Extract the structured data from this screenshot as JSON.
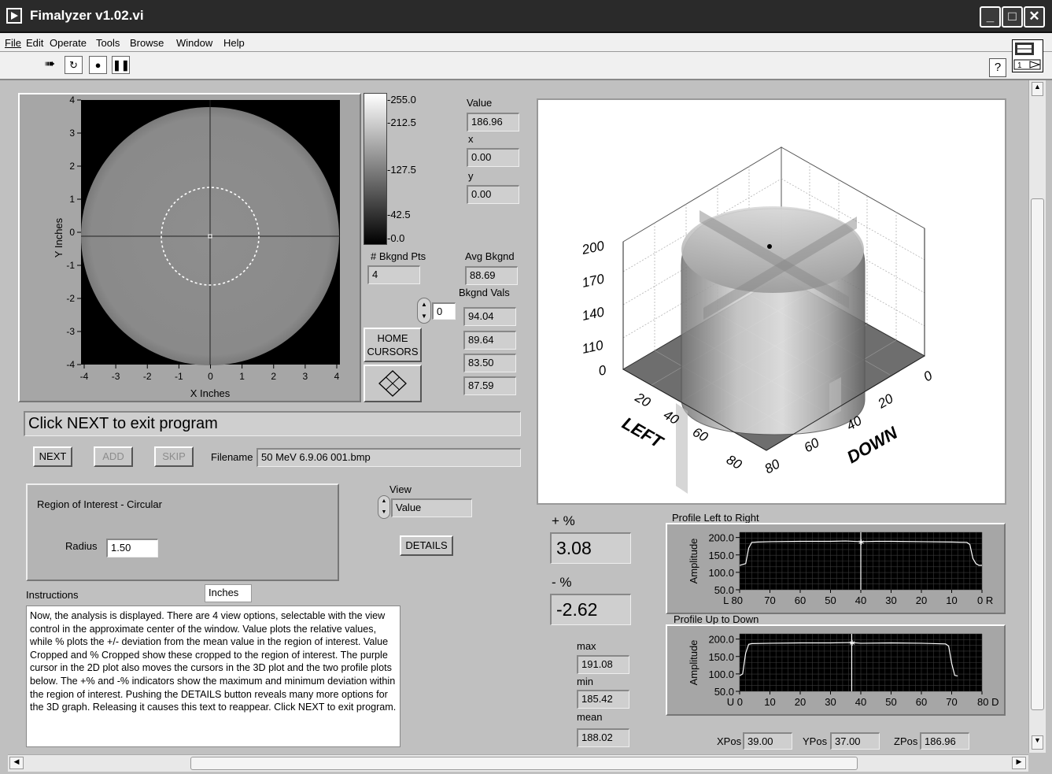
{
  "window": {
    "title": "Fimalyzer v1.02.vi"
  },
  "menu": {
    "items": [
      "File",
      "Edit",
      "Operate",
      "Tools",
      "Browse",
      "Window",
      "Help"
    ]
  },
  "toolbar": {
    "help_label": "?",
    "context_num": "1"
  },
  "plot2d": {
    "ylabel": "Y Inches",
    "xlabel": "X Inches",
    "yticks": [
      "4",
      "3",
      "2",
      "1",
      "0",
      "-1",
      "-2",
      "-3",
      "-4"
    ],
    "xticks": [
      "-4",
      "-3",
      "-2",
      "-1",
      "0",
      "1",
      "2",
      "3",
      "4"
    ]
  },
  "colorbar": {
    "ticks": [
      "-255.0",
      "-212.5",
      "-127.5",
      "-42.5",
      "-0.0"
    ]
  },
  "readouts": {
    "value_label": "Value",
    "value": "186.96",
    "x_label": "x",
    "x": "0.00",
    "y_label": "y",
    "y": "0.00",
    "bkgnd_pts_label": "# Bkgnd Pts",
    "bkgnd_pts": "4",
    "avg_bkgnd_label": "Avg Bkgnd",
    "avg_bkgnd": "88.69",
    "bkgnd_vals_label": "Bkgnd Vals",
    "bkgnd_vals": [
      "94.04",
      "89.64",
      "83.50",
      "87.59"
    ],
    "index": "0"
  },
  "home_cursors_label": [
    "HOME",
    "CURSORS"
  ],
  "status": "Click NEXT to exit program",
  "buttons": {
    "next": "NEXT",
    "add": "ADD",
    "skip": "SKIP",
    "details": "DETAILS"
  },
  "filename": {
    "label": "Filename",
    "value": "50 MeV 6.9.06 001.bmp"
  },
  "roi": {
    "title": "Region of Interest - Circular",
    "radius_label": "Radius",
    "radius": "1.50"
  },
  "view": {
    "label": "View",
    "value": "Value"
  },
  "units": "Inches",
  "instructions": {
    "label": "Instructions",
    "text": "Now, the analysis is displayed. There are 4 view options, selectable with the view control in the approximate center of the window. Value plots the relative values, while % plots the +/- deviation from the mean value in the region of interest. Value Cropped and % Cropped show these cropped to the region of interest. The purple cursor in the 2D plot also moves the cursors in the 3D plot and the two profile plots below. The +% and -% indicators show the maximum and minimum deviation within the region of interest. Pushing the DETAILS button reveals many more options for the 3D graph. Releasing it causes this text to reappear. Click NEXT to exit program."
  },
  "plot3d": {
    "z_ticks": [
      "200",
      "170",
      "140",
      "110",
      "0"
    ],
    "left_ticks": [
      "20",
      "40",
      "60",
      "80"
    ],
    "down_ticks": [
      "0",
      "20",
      "40",
      "60",
      "80"
    ],
    "left_label": "LEFT",
    "down_label": "DOWN"
  },
  "stats": {
    "plus_label": "+ %",
    "plus": "3.08",
    "minus_label": "- %",
    "minus": "-2.62",
    "max_label": "max",
    "max": "191.08",
    "min_label": "min",
    "min": "185.42",
    "mean_label": "mean",
    "mean": "188.02"
  },
  "profiles": [
    {
      "title": "Profile Left to Right",
      "ylabel": "Amplitude",
      "yticks": [
        "200.0",
        "150.0",
        "100.0",
        "50.0"
      ],
      "xticks": [
        "L 80",
        "70",
        "60",
        "50",
        "40",
        "30",
        "20",
        "10",
        "0 R"
      ],
      "x_range": [
        80,
        0
      ],
      "cursor_x": 40,
      "chart_data": {
        "type": "line",
        "x": [
          80,
          78,
          77,
          76,
          74,
          70,
          60,
          50,
          45,
          40,
          35,
          30,
          20,
          10,
          5,
          4,
          3,
          2,
          1,
          0
        ],
        "y": [
          120,
          125,
          170,
          186,
          187,
          188,
          189,
          189,
          190,
          188,
          189,
          189,
          188,
          187,
          186,
          180,
          140,
          125,
          120,
          120
        ],
        "ylim": [
          50,
          215
        ]
      }
    },
    {
      "title": "Profile Up to Down",
      "ylabel": "Amplitude",
      "yticks": [
        "200.0",
        "150.0",
        "100.0",
        "50.0"
      ],
      "xticks": [
        "U 0",
        "10",
        "20",
        "30",
        "40",
        "50",
        "60",
        "70",
        "80 D"
      ],
      "x_range": [
        0,
        80
      ],
      "cursor_x": 37,
      "chart_data": {
        "type": "line",
        "x": [
          0,
          1,
          2,
          3,
          4,
          10,
          20,
          30,
          37,
          40,
          50,
          60,
          68,
          69,
          70,
          71,
          72
        ],
        "y": [
          95,
          100,
          160,
          185,
          187,
          188,
          189,
          189,
          190,
          188,
          189,
          188,
          186,
          180,
          130,
          96,
          94
        ],
        "ylim": [
          50,
          215
        ]
      }
    }
  ],
  "pos": {
    "xpos_label": "XPos",
    "xpos": "39.00",
    "ypos_label": "YPos",
    "ypos": "37.00",
    "zpos_label": "ZPos",
    "zpos": "186.96"
  }
}
